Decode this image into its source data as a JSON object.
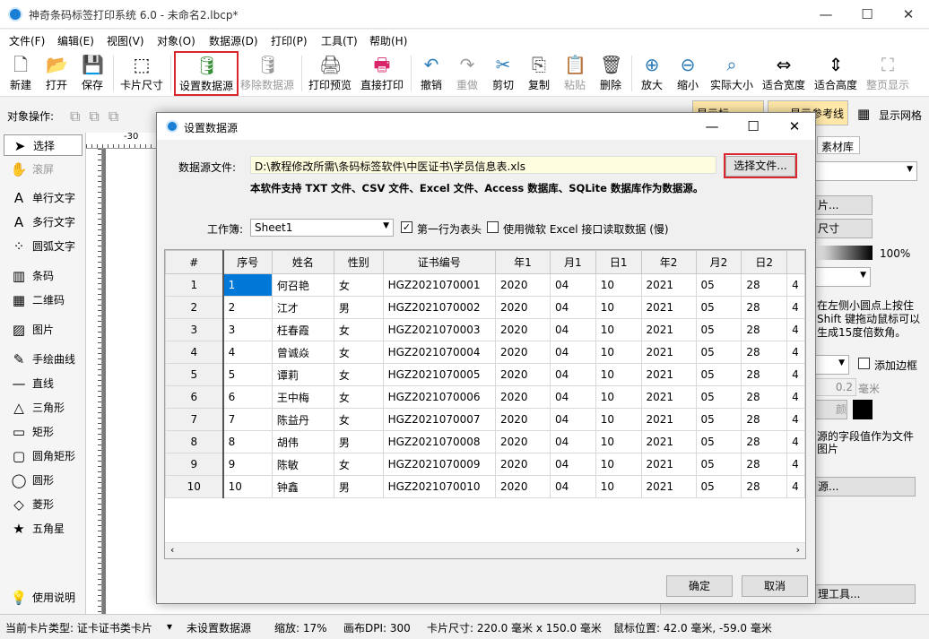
{
  "app": {
    "title": "神奇条码标签打印系统 6.0 - 未命名2.lbcp*"
  },
  "menu": [
    "文件(F)",
    "编辑(E)",
    "视图(V)",
    "对象(O)",
    "数据源(D)",
    "打印(P)",
    "工具(T)",
    "帮助(H)"
  ],
  "toolbar": [
    {
      "label": "新建",
      "icon": "new-file-icon",
      "glyph": "🗋"
    },
    {
      "label": "打开",
      "icon": "open-icon",
      "glyph": "📂"
    },
    {
      "label": "保存",
      "icon": "save-icon",
      "glyph": "💾"
    },
    {
      "label": "卡片尺寸",
      "icon": "card-size-icon",
      "glyph": "⬚"
    },
    {
      "label": "设置数据源",
      "icon": "database-icon",
      "glyph": "🛢"
    },
    {
      "label": "移除数据源",
      "icon": "remove-database-icon",
      "glyph": "🛢"
    },
    {
      "label": "打印预览",
      "icon": "print-preview-icon",
      "glyph": "🖨"
    },
    {
      "label": "直接打印",
      "icon": "print-icon",
      "glyph": "🖶"
    },
    {
      "label": "撤销",
      "icon": "undo-icon",
      "glyph": "↶"
    },
    {
      "label": "重做",
      "icon": "redo-icon",
      "glyph": "↷"
    },
    {
      "label": "剪切",
      "icon": "cut-icon",
      "glyph": "✂"
    },
    {
      "label": "复制",
      "icon": "copy-icon",
      "glyph": "⎘"
    },
    {
      "label": "粘贴",
      "icon": "paste-icon",
      "glyph": "📋"
    },
    {
      "label": "删除",
      "icon": "delete-icon",
      "glyph": "🗑"
    },
    {
      "label": "放大",
      "icon": "zoom-in-icon",
      "glyph": "⊕"
    },
    {
      "label": "缩小",
      "icon": "zoom-out-icon",
      "glyph": "⊖"
    },
    {
      "label": "实际大小",
      "icon": "actual-size-icon",
      "glyph": "⌕"
    },
    {
      "label": "适合宽度",
      "icon": "fit-width-icon",
      "glyph": "⇔"
    },
    {
      "label": "适合高度",
      "icon": "fit-height-icon",
      "glyph": "⇕"
    },
    {
      "label": "整页显示",
      "icon": "fit-page-icon",
      "glyph": "⛶"
    }
  ],
  "ops": {
    "label": "对象操作:"
  },
  "left_tools": [
    {
      "label": "选择",
      "icon": "select-arrow-icon",
      "glyph": "➤"
    },
    {
      "label": "滚屏",
      "icon": "hand-icon",
      "glyph": "✋"
    },
    {
      "label": "单行文字",
      "icon": "single-line-text-icon",
      "glyph": "A"
    },
    {
      "label": "多行文字",
      "icon": "multi-line-text-icon",
      "glyph": "A"
    },
    {
      "label": "圆弧文字",
      "icon": "arc-text-icon",
      "glyph": "⁘"
    },
    {
      "label": "条码",
      "icon": "barcode-icon",
      "glyph": "▥"
    },
    {
      "label": "二维码",
      "icon": "qrcode-icon",
      "glyph": "▦"
    },
    {
      "label": "图片",
      "icon": "image-icon",
      "glyph": "▨"
    },
    {
      "label": "手绘曲线",
      "icon": "pen-icon",
      "glyph": "✎"
    },
    {
      "label": "直线",
      "icon": "line-icon",
      "glyph": "—"
    },
    {
      "label": "三角形",
      "icon": "triangle-icon",
      "glyph": "△"
    },
    {
      "label": "矩形",
      "icon": "rectangle-icon",
      "glyph": "▭"
    },
    {
      "label": "圆角矩形",
      "icon": "rounded-rect-icon",
      "glyph": "▢"
    },
    {
      "label": "圆形",
      "icon": "circle-icon",
      "glyph": "◯"
    },
    {
      "label": "菱形",
      "icon": "diamond-icon",
      "glyph": "◇"
    },
    {
      "label": "五角星",
      "icon": "star-icon",
      "glyph": "★"
    },
    {
      "label": "使用说明",
      "icon": "bulb-icon",
      "glyph": "💡"
    }
  ],
  "ruler": {
    "mark": "-30"
  },
  "right_panel": {
    "btn_show_tag": "显示标",
    "btn_show_ref": "显示参考线",
    "show_grid": "显示网格",
    "tab_material": "素材库",
    "card_btn": "片...",
    "size_btn": "尺寸",
    "opacity": "100%",
    "hint": "在左侧小圆点上按住 Shift 键拖动鼠标可以生成15度倍数角。",
    "add_border": "添加边框",
    "border_width": "0.2",
    "unit": "毫米",
    "color_btn": "颜色...",
    "field_hint": "源的字段值作为文件图片",
    "source_btn": "源...",
    "tools_btn": "理工具..."
  },
  "status": {
    "card_type": "当前卡片类型: 证卡证书类卡片",
    "datasource": "未设置数据源",
    "zoom": "缩放: 17%",
    "dpi": "画布DPI: 300",
    "card_size": "卡片尺寸: 220.0 毫米 x 150.0 毫米",
    "mouse": "鼠标位置: 42.0 毫米, -59.0 毫米"
  },
  "dialog": {
    "title": "设置数据源",
    "file_label": "数据源文件:",
    "file_path": "D:\\教程修改所需\\条码标签软件\\中医证书\\学员信息表.xls",
    "select_file": "选择文件...",
    "support_text": "本软件支持 TXT 文件、CSV 文件、Excel 文件、Access 数据库、SQLite 数据库作为数据源。",
    "sheet_label": "工作簿:",
    "sheet_value": "Sheet1",
    "first_row_header": "第一行为表头",
    "use_ms_excel": "使用微软 Excel 接口读取数据 (慢)",
    "ok": "确定",
    "cancel": "取消",
    "columns": [
      "#",
      "序号",
      "姓名",
      "性别",
      "证书编号",
      "年1",
      "月1",
      "日1",
      "年2",
      "月2",
      "日2",
      ""
    ],
    "rows": [
      [
        "1",
        "1",
        "何召艳",
        "女",
        "HGZ2021070001",
        "2020",
        "04",
        "10",
        "2021",
        "05",
        "28",
        "4"
      ],
      [
        "2",
        "2",
        "江才",
        "男",
        "HGZ2021070002",
        "2020",
        "04",
        "10",
        "2021",
        "05",
        "28",
        "4"
      ],
      [
        "3",
        "3",
        "枉春霞",
        "女",
        "HGZ2021070003",
        "2020",
        "04",
        "10",
        "2021",
        "05",
        "28",
        "4"
      ],
      [
        "4",
        "4",
        "曾诚焱",
        "女",
        "HGZ2021070004",
        "2020",
        "04",
        "10",
        "2021",
        "05",
        "28",
        "4"
      ],
      [
        "5",
        "5",
        "谭莉",
        "女",
        "HGZ2021070005",
        "2020",
        "04",
        "10",
        "2021",
        "05",
        "28",
        "4"
      ],
      [
        "6",
        "6",
        "王中梅",
        "女",
        "HGZ2021070006",
        "2020",
        "04",
        "10",
        "2021",
        "05",
        "28",
        "4"
      ],
      [
        "7",
        "7",
        "陈益丹",
        "女",
        "HGZ2021070007",
        "2020",
        "04",
        "10",
        "2021",
        "05",
        "28",
        "4"
      ],
      [
        "8",
        "8",
        "胡伟",
        "男",
        "HGZ2021070008",
        "2020",
        "04",
        "10",
        "2021",
        "05",
        "28",
        "4"
      ],
      [
        "9",
        "9",
        "陈敏",
        "女",
        "HGZ2021070009",
        "2020",
        "04",
        "10",
        "2021",
        "05",
        "28",
        "4"
      ],
      [
        "10",
        "10",
        "钟鑫",
        "男",
        "HGZ2021070010",
        "2020",
        "04",
        "10",
        "2021",
        "05",
        "28",
        "4"
      ]
    ]
  },
  "colors": {
    "highlight": "#d9262c",
    "selection": "#0078d7",
    "path_bg": "#fffde0"
  }
}
